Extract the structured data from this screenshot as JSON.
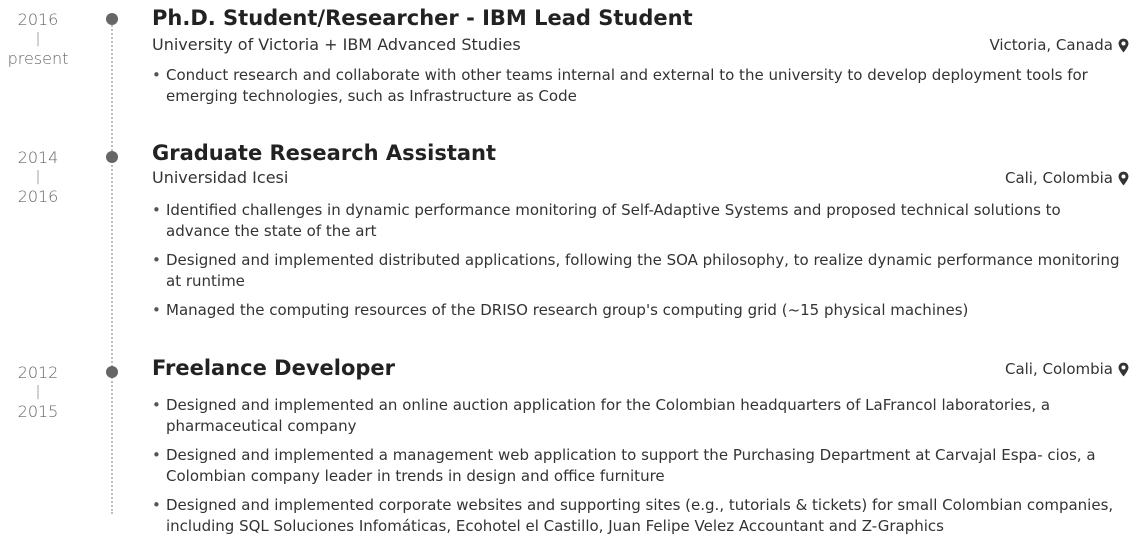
{
  "entries": [
    {
      "date_start": "2016",
      "date_sep": "|",
      "date_end": "present",
      "title": "Ph.D. Student/Researcher - IBM Lead Student",
      "organization": "University of Victoria + IBM Advanced Studies",
      "location": "Victoria, Canada",
      "location_icon": "map-pin-icon",
      "bullets": [
        "Conduct research and collaborate with other teams internal and external to the university to develop deployment tools for emerging technologies, such as Infrastructure as Code"
      ]
    },
    {
      "date_start": "2014",
      "date_sep": "|",
      "date_end": "2016",
      "title": "Graduate Research Assistant",
      "organization": "Universidad Icesi",
      "location": "Cali, Colombia",
      "location_icon": "map-pin-icon",
      "bullets": [
        "Identified challenges in dynamic performance monitoring of Self-Adaptive Systems and proposed technical solutions to advance the state of the art",
        "Designed and implemented distributed applications, following the SOA philosophy, to realize dynamic performance monitoring at runtime",
        "Managed the computing resources of the DRISO research group's computing grid (~15 physical machines)"
      ]
    },
    {
      "date_start": "2012",
      "date_sep": "|",
      "date_end": "2015",
      "title": "Freelance Developer",
      "location": "Cali, Colombia",
      "location_icon": "map-pin-icon",
      "bullets": [
        "Designed and implemented an online auction application for the Colombian headquarters of LaFrancol laboratories, a pharmaceutical company",
        "Designed and implemented a management web application to support the Purchasing Department at Carvajal Espa- cios, a Colombian company leader in trends in design and office furniture",
        "Designed and implemented corporate websites and supporting sites (e.g., tutorials & tickets) for small Colombian companies, including SQL Soluciones Infomáticas, Ecohotel el Castillo, Juan Felipe Velez Accountant and Z-Graphics"
      ]
    }
  ],
  "bullet_glyph": "•",
  "colors": {
    "dot": "#666666",
    "text": "#333333",
    "title": "#222222",
    "timeline": "#bdbdbd"
  }
}
